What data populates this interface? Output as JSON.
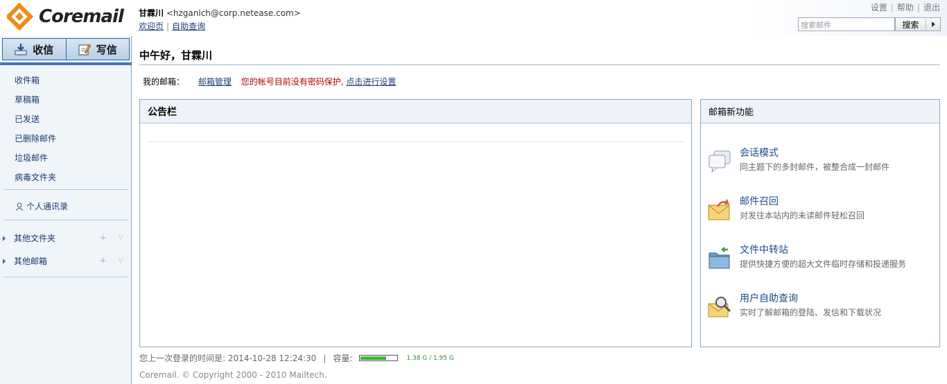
{
  "header": {
    "brand": "Coremail",
    "user_name": "甘霖川",
    "user_email": "<hzganlch@corp.netease.com>",
    "links": [
      "欢迎页",
      "自助查询"
    ],
    "top_links": [
      "设置",
      "帮助",
      "退出"
    ],
    "search_placeholder": "搜索邮件",
    "search_button": "搜索"
  },
  "sidebar": {
    "receive_label": "收信",
    "compose_label": "写信",
    "folders": [
      "收件箱",
      "草稿箱",
      "已发送",
      "已删除邮件",
      "垃圾邮件",
      "病毒文件夹"
    ],
    "contacts_label": "个人通讯录",
    "other_folders_label": "其他文件夹",
    "other_mailboxes_label": "其他邮箱"
  },
  "main": {
    "greeting": "中午好，甘霖川",
    "mailbox_label": "我的邮箱：",
    "manage_link": "邮箱管理",
    "warning_text": "您的帐号目前没有密码保护,",
    "setup_link": "点击进行设置",
    "notice_title": "公告栏",
    "features_title": "邮箱新功能",
    "features": [
      {
        "title": "会话模式",
        "desc": "同主题下的多封邮件，被整合成一封邮件",
        "icon": "chat-bubble-icon"
      },
      {
        "title": "邮件召回",
        "desc": "对发往本站内的未读邮件轻松召回",
        "icon": "mail-recall-icon"
      },
      {
        "title": "文件中转站",
        "desc": "提供快捷方便的超大文件临时存储和投递服务",
        "icon": "file-transfer-icon"
      },
      {
        "title": "用户自助查询",
        "desc": "实时了解邮箱的登陆、发信和下载状况",
        "icon": "mail-search-icon"
      }
    ]
  },
  "footer": {
    "last_login": "您上一次登录的时间是: 2014-10-28 12:24:30",
    "capacity_label": "容量:",
    "capacity_text": "1.38 G / 1.95 G",
    "capacity_fraction": 0.71,
    "copyright": "Coremail. © Copyright 2000 - 2010 Mailtech."
  },
  "colors": {
    "accent": "#3e78b5",
    "warning": "#b00000",
    "link": "#1f3f7a",
    "capacity": "#2c8c2c"
  }
}
